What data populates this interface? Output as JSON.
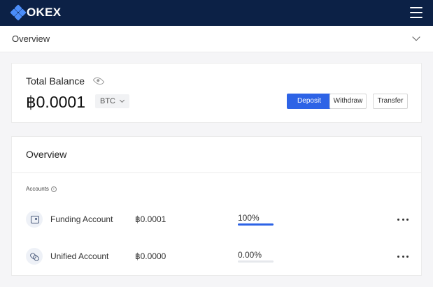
{
  "header": {
    "brand": "OKEX",
    "menu_icon": "hamburger-menu-icon"
  },
  "subbar": {
    "title": "Overview",
    "icon": "chevron-down-icon"
  },
  "balance": {
    "label": "Total Balance",
    "visibility_icon": "eye-icon",
    "value": "฿0.0001",
    "currency": "BTC",
    "buttons": {
      "deposit": "Deposit",
      "withdraw": "Withdraw",
      "transfer": "Transfer"
    },
    "deposit_color": "#2d63e6"
  },
  "overview": {
    "title": "Overview",
    "accounts_label": "Accounts",
    "info_icon": "info-icon",
    "accounts": [
      {
        "name": "Funding Account",
        "amount": "฿0.0001",
        "percent": "100%",
        "share": 1.0,
        "icon": "wallet-icon"
      },
      {
        "name": "Unified Account",
        "amount": "฿0.0000",
        "percent": "0.00%",
        "share": 0.0,
        "icon": "link-icon"
      }
    ]
  }
}
